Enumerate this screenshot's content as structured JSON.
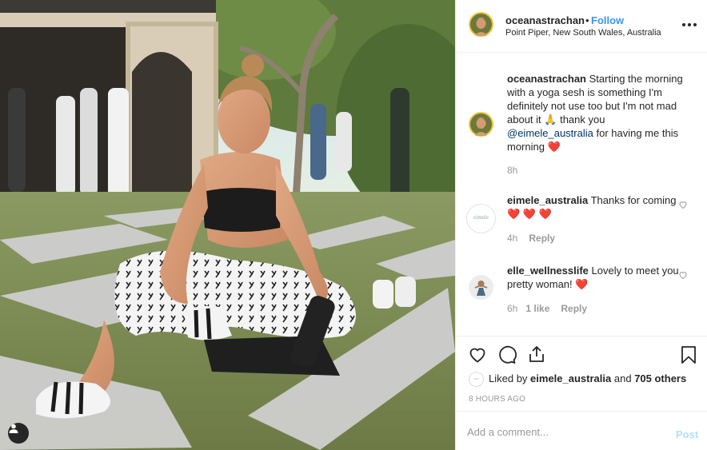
{
  "header": {
    "username": "oceanastrachan",
    "separator": "•",
    "follow_label": "Follow",
    "location": "Point Piper, New South Wales, Australia"
  },
  "caption": {
    "username": "oceanastrachan",
    "text_part1": "Starting the morning with a yoga sesh is something I'm definitely not use too but I'm not mad about it",
    "emoji_1": "🙏",
    "text_part2": "thank you",
    "mention": "@eimele_australia",
    "text_part3": "for having me this morning",
    "emoji_2": "❤️",
    "time": "8h"
  },
  "comments": [
    {
      "username": "eimele_australia",
      "text": "Thanks for coming",
      "emoji": "❤️ ❤️ ❤️",
      "avatar_text": "eimele",
      "time": "4h",
      "likes": "",
      "reply_label": "Reply"
    },
    {
      "username": "elle_wellnesslife",
      "text": "Lovely to meet you pretty woman!",
      "emoji": "❤️",
      "time": "6h",
      "likes": "1 like",
      "reply_label": "Reply"
    }
  ],
  "likes": {
    "prefix": "Liked by",
    "user": "eimele_australia",
    "middle": "and",
    "count": "705 others"
  },
  "timestamp": "8 HOURS AGO",
  "add_comment": {
    "placeholder": "Add a comment...",
    "post_label": "Post"
  },
  "colors": {
    "accent": "#3897f0",
    "post_disabled": "#b2dffc",
    "mention": "#003569",
    "muted": "#999999",
    "heart": "#ed4956"
  },
  "icons": [
    "user-tag-icon",
    "heart-icon",
    "comment-icon",
    "share-icon",
    "bookmark-icon",
    "more-icon",
    "small-heart-icon"
  ]
}
